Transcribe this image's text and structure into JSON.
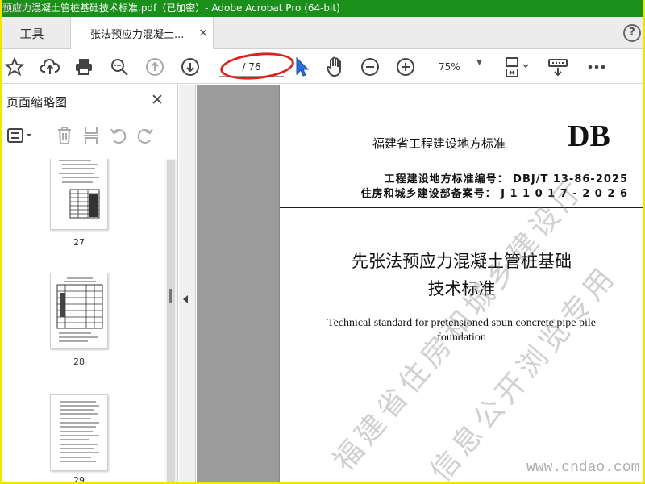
{
  "window": {
    "title": "预应力混凝土管桩基础技术标准.pdf（已加密）- Adobe Acrobat Pro (64-bit)"
  },
  "tabs": {
    "tools_label": "工具",
    "doc_label": "张法预应力混凝土...",
    "doc_close": "×",
    "help": "?"
  },
  "toolbar": {
    "page_current": "",
    "page_total": "/ 76",
    "zoom": "75%",
    "icons": [
      "star-icon",
      "upload-icon",
      "print-icon",
      "zoom-search-icon",
      "page-up-icon",
      "page-down-icon",
      "pointer-icon",
      "hand-icon",
      "zoom-out-icon",
      "zoom-in-icon",
      "fit-page-icon",
      "scroll-mode-icon",
      "more-icon"
    ]
  },
  "panel": {
    "title": "页面缩略图",
    "close": "✕",
    "thumbnails": [
      {
        "page": "27"
      },
      {
        "page": "28"
      },
      {
        "page": "29"
      }
    ]
  },
  "document": {
    "header": "福建省工程建设地方标准",
    "code": "DB",
    "std_number": "工程建设地方标准编号： DBJ/T 13-86-2025",
    "record_number": "住房和城乡建设部备案号： J 1 1 0 1 7 - 2 0 2 6",
    "title_line1": "先张法预应力混凝土管桩基础",
    "title_line2": "技术标准",
    "english_title": "Technical standard for pretensioned spun concrete pipe pile foundation"
  },
  "watermarks": {
    "corner": "道桥网",
    "diag1": "福建省住房和城乡建设厅",
    "diag2": "信息公开浏览专用",
    "url": "www.cndao.com"
  },
  "colors": {
    "titlebar": "#1a8f1a",
    "border": "#f2e600",
    "annotation": "#e02020",
    "pointer": "#2a6fdb"
  }
}
